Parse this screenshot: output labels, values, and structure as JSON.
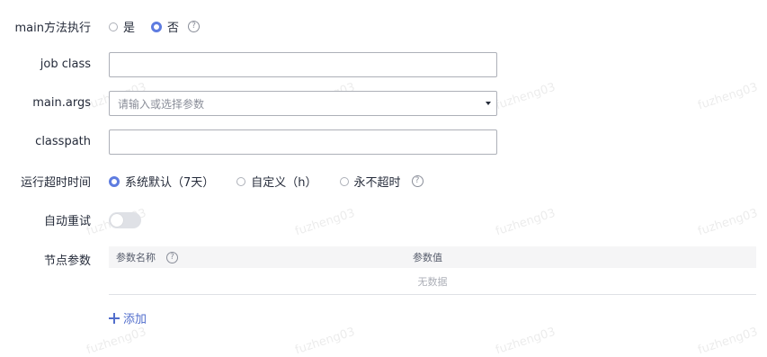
{
  "form": {
    "main_exec": {
      "label": "main方法执行",
      "options": [
        {
          "label": "是",
          "checked": false
        },
        {
          "label": "否",
          "checked": true
        }
      ]
    },
    "job_class": {
      "label": "job class",
      "value": ""
    },
    "main_args": {
      "label": "main.args",
      "placeholder": "请输入或选择参数"
    },
    "classpath": {
      "label": "classpath",
      "value": ""
    },
    "timeout": {
      "label": "运行超时时间",
      "options": [
        {
          "label": "系统默认（7天）",
          "checked": true
        },
        {
          "label": "自定义（h）",
          "checked": false
        },
        {
          "label": "永不超时",
          "checked": false
        }
      ]
    },
    "auto_retry": {
      "label": "自动重试",
      "enabled": false
    },
    "node_params": {
      "label": "节点参数",
      "columns": [
        "参数名称",
        "参数值"
      ],
      "empty_text": "无数据",
      "add_label": "添加"
    }
  },
  "help_icon_text": "?",
  "watermark": "fuzheng03",
  "colors": {
    "accent": "#5e7ce0",
    "link": "#526ecc",
    "border": "#adb0b8"
  }
}
